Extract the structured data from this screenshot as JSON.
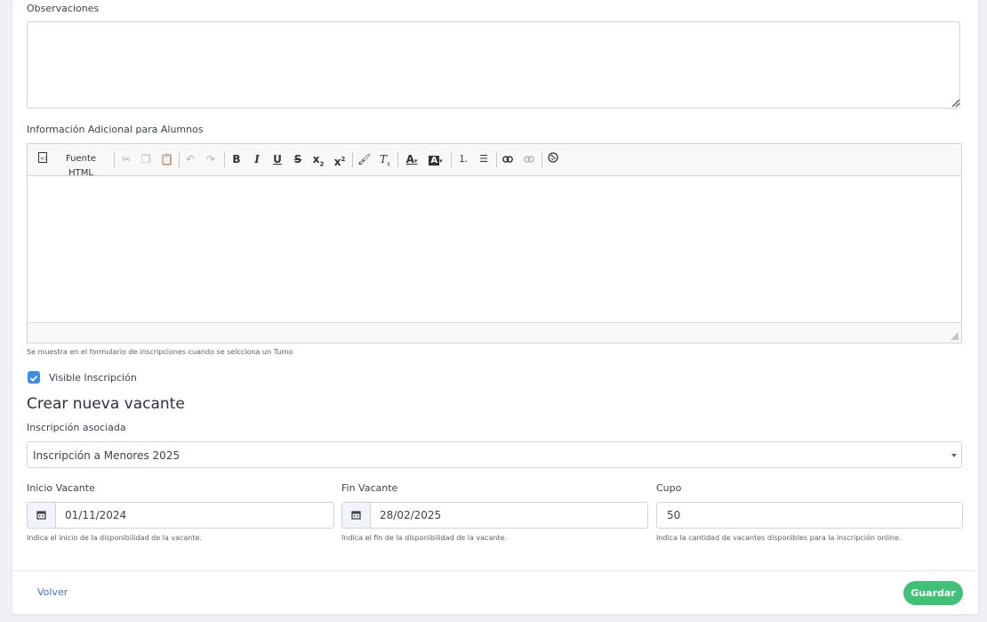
{
  "form": {
    "observaciones_label": "Observaciones",
    "observaciones_value": "",
    "info_label": "Información Adicional para Alumnos",
    "info_help": "Se muestra en el formulario de inscripciones cuando se selcciona un Turno",
    "visible_label": "Visible Inscripción",
    "visible_checked": true
  },
  "toolbar": {
    "source_label": "Fuente HTML",
    "icons": [
      "source-icon",
      "cut-icon",
      "copy-icon",
      "paste-icon",
      "undo-icon",
      "redo-icon",
      "bold-icon",
      "italic-icon",
      "underline-icon",
      "strike-icon",
      "subscript-icon",
      "superscript-icon",
      "format-painter-icon",
      "clear-format-icon",
      "text-color-icon",
      "bg-color-icon",
      "numbered-list-icon",
      "bullet-list-icon",
      "link-icon",
      "unlink-icon",
      "globe-icon"
    ]
  },
  "vacante": {
    "title": "Crear nueva vacante",
    "inscripcion_label": "Inscripción asociada",
    "inscripcion_value": "Inscripción a Menores 2025",
    "inicio_label": "Inicio Vacante",
    "inicio_value": "01/11/2024",
    "inicio_help": "Indica el inicio de la disponibilidad de la vacante.",
    "fin_label": "Fin Vacante",
    "fin_value": "28/02/2025",
    "fin_help": "Indica el fin de la disponibilidad de la vacante.",
    "cupo_label": "Cupo",
    "cupo_value": "50",
    "cupo_help": "Indica la cantidad de vacantes disponibles para la inscripción online."
  },
  "footer": {
    "back_label": "Volver",
    "save_label": "Guardar"
  },
  "colors": {
    "accent": "#3b8dec",
    "save": "#40c276",
    "link": "#3f73d0"
  }
}
